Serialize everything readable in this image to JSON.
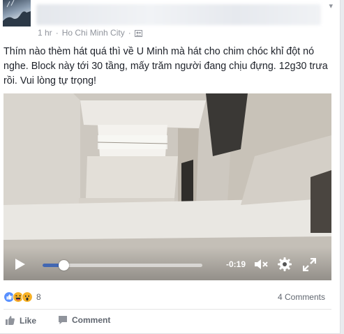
{
  "post": {
    "time_ago": "1 hr",
    "separator": "·",
    "location": "Ho Chi Minh City",
    "audience_icon": "friends-icon",
    "text": "Thím nào thèm hát quá thì về U Minh mà hát cho chim chóc khỉ đột nó nghe. Block này tới 30 tầng, mấy trăm người đang chịu đựng. 12g30 trưa rồi. Vui lòng tự trọng!"
  },
  "video": {
    "time_remaining": "-0:19",
    "progress_fraction": 0.13,
    "accent_color": "#4267b2"
  },
  "engagement": {
    "reaction_icons": [
      "like-icon",
      "haha-icon",
      "wow-icon"
    ],
    "reaction_count": "8",
    "comments_label": "4 Comments"
  },
  "actions": {
    "like_label": "Like",
    "comment_label": "Comment"
  }
}
